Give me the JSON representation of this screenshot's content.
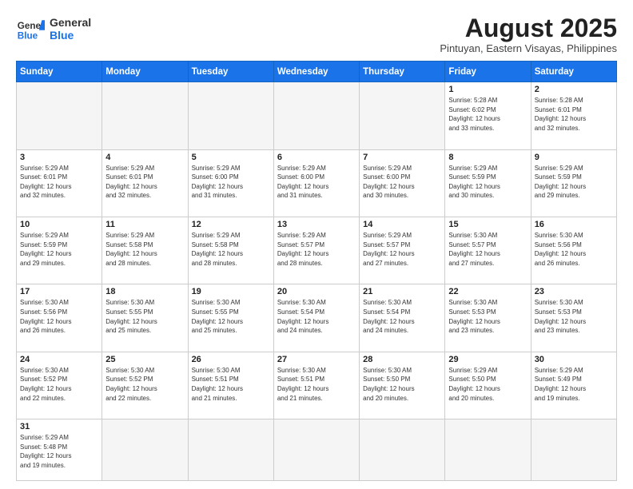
{
  "header": {
    "logo_general": "General",
    "logo_blue": "Blue",
    "month_title": "August 2025",
    "subtitle": "Pintuyan, Eastern Visayas, Philippines"
  },
  "weekdays": [
    "Sunday",
    "Monday",
    "Tuesday",
    "Wednesday",
    "Thursday",
    "Friday",
    "Saturday"
  ],
  "weeks": [
    [
      {
        "day": "",
        "info": ""
      },
      {
        "day": "",
        "info": ""
      },
      {
        "day": "",
        "info": ""
      },
      {
        "day": "",
        "info": ""
      },
      {
        "day": "",
        "info": ""
      },
      {
        "day": "1",
        "info": "Sunrise: 5:28 AM\nSunset: 6:02 PM\nDaylight: 12 hours\nand 33 minutes."
      },
      {
        "day": "2",
        "info": "Sunrise: 5:28 AM\nSunset: 6:01 PM\nDaylight: 12 hours\nand 32 minutes."
      }
    ],
    [
      {
        "day": "3",
        "info": "Sunrise: 5:29 AM\nSunset: 6:01 PM\nDaylight: 12 hours\nand 32 minutes."
      },
      {
        "day": "4",
        "info": "Sunrise: 5:29 AM\nSunset: 6:01 PM\nDaylight: 12 hours\nand 32 minutes."
      },
      {
        "day": "5",
        "info": "Sunrise: 5:29 AM\nSunset: 6:00 PM\nDaylight: 12 hours\nand 31 minutes."
      },
      {
        "day": "6",
        "info": "Sunrise: 5:29 AM\nSunset: 6:00 PM\nDaylight: 12 hours\nand 31 minutes."
      },
      {
        "day": "7",
        "info": "Sunrise: 5:29 AM\nSunset: 6:00 PM\nDaylight: 12 hours\nand 30 minutes."
      },
      {
        "day": "8",
        "info": "Sunrise: 5:29 AM\nSunset: 5:59 PM\nDaylight: 12 hours\nand 30 minutes."
      },
      {
        "day": "9",
        "info": "Sunrise: 5:29 AM\nSunset: 5:59 PM\nDaylight: 12 hours\nand 29 minutes."
      }
    ],
    [
      {
        "day": "10",
        "info": "Sunrise: 5:29 AM\nSunset: 5:59 PM\nDaylight: 12 hours\nand 29 minutes."
      },
      {
        "day": "11",
        "info": "Sunrise: 5:29 AM\nSunset: 5:58 PM\nDaylight: 12 hours\nand 28 minutes."
      },
      {
        "day": "12",
        "info": "Sunrise: 5:29 AM\nSunset: 5:58 PM\nDaylight: 12 hours\nand 28 minutes."
      },
      {
        "day": "13",
        "info": "Sunrise: 5:29 AM\nSunset: 5:57 PM\nDaylight: 12 hours\nand 28 minutes."
      },
      {
        "day": "14",
        "info": "Sunrise: 5:29 AM\nSunset: 5:57 PM\nDaylight: 12 hours\nand 27 minutes."
      },
      {
        "day": "15",
        "info": "Sunrise: 5:30 AM\nSunset: 5:57 PM\nDaylight: 12 hours\nand 27 minutes."
      },
      {
        "day": "16",
        "info": "Sunrise: 5:30 AM\nSunset: 5:56 PM\nDaylight: 12 hours\nand 26 minutes."
      }
    ],
    [
      {
        "day": "17",
        "info": "Sunrise: 5:30 AM\nSunset: 5:56 PM\nDaylight: 12 hours\nand 26 minutes."
      },
      {
        "day": "18",
        "info": "Sunrise: 5:30 AM\nSunset: 5:55 PM\nDaylight: 12 hours\nand 25 minutes."
      },
      {
        "day": "19",
        "info": "Sunrise: 5:30 AM\nSunset: 5:55 PM\nDaylight: 12 hours\nand 25 minutes."
      },
      {
        "day": "20",
        "info": "Sunrise: 5:30 AM\nSunset: 5:54 PM\nDaylight: 12 hours\nand 24 minutes."
      },
      {
        "day": "21",
        "info": "Sunrise: 5:30 AM\nSunset: 5:54 PM\nDaylight: 12 hours\nand 24 minutes."
      },
      {
        "day": "22",
        "info": "Sunrise: 5:30 AM\nSunset: 5:53 PM\nDaylight: 12 hours\nand 23 minutes."
      },
      {
        "day": "23",
        "info": "Sunrise: 5:30 AM\nSunset: 5:53 PM\nDaylight: 12 hours\nand 23 minutes."
      }
    ],
    [
      {
        "day": "24",
        "info": "Sunrise: 5:30 AM\nSunset: 5:52 PM\nDaylight: 12 hours\nand 22 minutes."
      },
      {
        "day": "25",
        "info": "Sunrise: 5:30 AM\nSunset: 5:52 PM\nDaylight: 12 hours\nand 22 minutes."
      },
      {
        "day": "26",
        "info": "Sunrise: 5:30 AM\nSunset: 5:51 PM\nDaylight: 12 hours\nand 21 minutes."
      },
      {
        "day": "27",
        "info": "Sunrise: 5:30 AM\nSunset: 5:51 PM\nDaylight: 12 hours\nand 21 minutes."
      },
      {
        "day": "28",
        "info": "Sunrise: 5:30 AM\nSunset: 5:50 PM\nDaylight: 12 hours\nand 20 minutes."
      },
      {
        "day": "29",
        "info": "Sunrise: 5:29 AM\nSunset: 5:50 PM\nDaylight: 12 hours\nand 20 minutes."
      },
      {
        "day": "30",
        "info": "Sunrise: 5:29 AM\nSunset: 5:49 PM\nDaylight: 12 hours\nand 19 minutes."
      }
    ],
    [
      {
        "day": "31",
        "info": "Sunrise: 5:29 AM\nSunset: 5:48 PM\nDaylight: 12 hours\nand 19 minutes."
      },
      {
        "day": "",
        "info": ""
      },
      {
        "day": "",
        "info": ""
      },
      {
        "day": "",
        "info": ""
      },
      {
        "day": "",
        "info": ""
      },
      {
        "day": "",
        "info": ""
      },
      {
        "day": "",
        "info": ""
      }
    ]
  ]
}
